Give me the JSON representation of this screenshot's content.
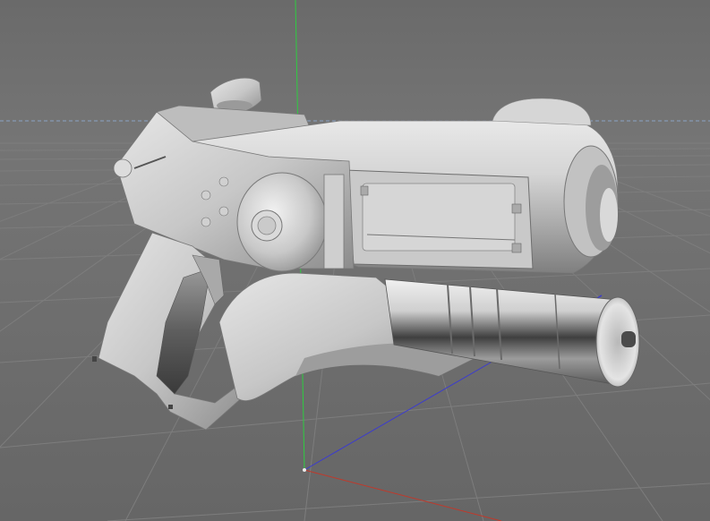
{
  "viewport": {
    "background_color": "#6b6b6b",
    "grid_color": "#7c7c7c",
    "horizon_line_color": "#8aa2c4",
    "axis_colors": {
      "x": "#c0392b",
      "y": "#2ecc40",
      "z": "#3b3bd0"
    },
    "model": {
      "name": "pistol-model",
      "material_color": "#d8d8d8",
      "shading": "smooth-gray"
    }
  }
}
